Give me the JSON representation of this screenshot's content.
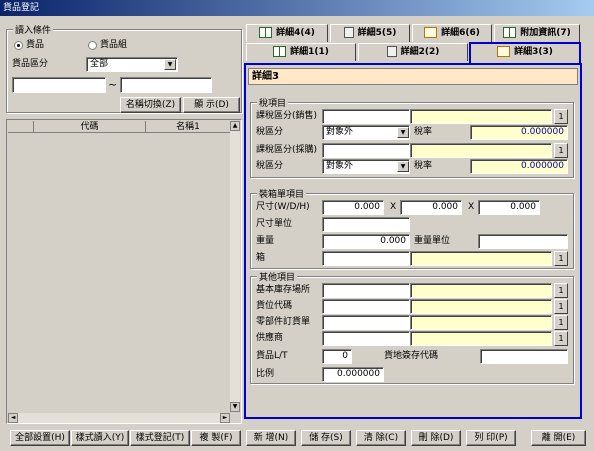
{
  "window": {
    "title": "貨品登記"
  },
  "left": {
    "group_title": "讀入條件",
    "radio_goods": "貨品",
    "radio_goods_group": "貨品組",
    "category_label": "貨品區分",
    "category_value": "全部",
    "range_separator": "~",
    "range_from": "",
    "range_to": "",
    "btn_name_switch": "名稱切換(Z)",
    "btn_show": "顯 示(D)",
    "col_code": "代碼",
    "col_name": "名稱1",
    "scroll_up": "▲",
    "scroll_down": "▼",
    "scroll_left": "◄",
    "scroll_right": "►"
  },
  "tabs_row1": [
    {
      "label": "詳細4(4)",
      "icon": "book-icon"
    },
    {
      "label": "詳細5(5)",
      "icon": "document-icon"
    },
    {
      "label": "詳細6(6)",
      "icon": "image-icon"
    },
    {
      "label": "附加資訊(7)",
      "icon": "book-icon"
    }
  ],
  "tabs_row2": [
    {
      "label": "詳細1(1)",
      "icon": "book-icon"
    },
    {
      "label": "詳細2(2)",
      "icon": "document-icon"
    },
    {
      "label": "詳細3(3)",
      "icon": "image-icon"
    }
  ],
  "panel": {
    "header": "詳細3",
    "tax": {
      "title": "稅項目",
      "sales_tax_class_label": "課稅區分(銷售)",
      "sales_tax_class_code": "",
      "sales_tax_class_name": "",
      "tax_type_label": "稅區分",
      "tax_type_value": "對象外",
      "tax_rate_label": "稅率",
      "tax_rate_value": "0.000000",
      "purchase_tax_class_label": "課稅區分(採購)",
      "purchase_tax_class_code": "",
      "purchase_tax_class_name": "",
      "tax_type2_label": "稅區分",
      "tax_type2_value": "對象外",
      "tax_rate2_label": "稅率",
      "tax_rate2_value": "0.000000",
      "ellipsis": "1"
    },
    "packing": {
      "title": "裝箱單項目",
      "size_label": "尺寸(W/D/H)",
      "w": "0.000",
      "d": "0.000",
      "h": "0.000",
      "x1": "X",
      "x2": "X",
      "size_unit_label": "尺寸單位",
      "size_unit_value": "",
      "weight_label": "重量",
      "weight_value": "0.000",
      "weight_unit_label": "重量單位",
      "weight_unit_value": "",
      "box_label": "箱",
      "box_code": "",
      "box_name": ""
    },
    "other": {
      "title": "其他項目",
      "base_location_label": "基本庫存場所",
      "location_code_label": "貨位代碼",
      "parts_order_label": "零部件訂貨單",
      "supplier_label": "供應商",
      "lead_time_label": "貨品L/T",
      "lead_time_value": "0",
      "cargo_code_label": "貨地簽存代碼",
      "cargo_code_value": "",
      "ratio_label": "比例",
      "ratio_value": "0.000000"
    }
  },
  "toolbar": [
    "全部設置(H)",
    "樣式讀入(Y)",
    "樣式登記(T)",
    "複 製(F)",
    "新 增(N)",
    "儲 存(S)",
    "清 除(C)",
    "刪 除(D)",
    "列 印(P)",
    "離 開(E)"
  ],
  "colors": {
    "highlight_border": "#0000c8",
    "header_bg": "#ffe8c8",
    "readonly_bg": "#ffffcc"
  }
}
